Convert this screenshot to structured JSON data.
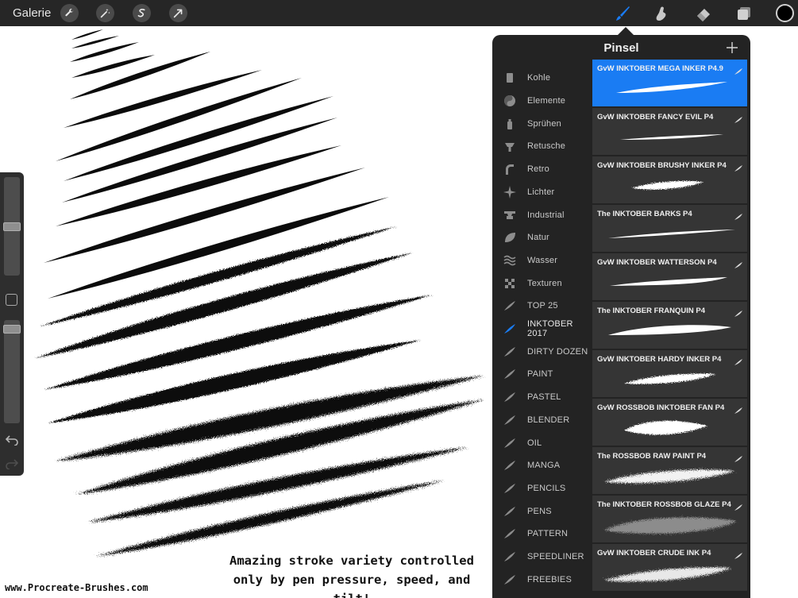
{
  "toolbar": {
    "gallery_label": "Galerie",
    "left_tools": [
      "wrench-icon",
      "magic-wand-icon",
      "selection-icon",
      "transform-arrow-icon"
    ],
    "right_tools": [
      "brush-icon",
      "smudge-icon",
      "eraser-icon",
      "layers-icon"
    ],
    "active_tool": "brush-icon",
    "accent_color": "#1a7cf3",
    "current_color": "#000000"
  },
  "sidebar": {
    "brush_size_level": 0.5,
    "opacity_level": 0.95
  },
  "panel": {
    "title": "Pinsel",
    "add_icon": "plus-icon",
    "categories": [
      {
        "label": "Kohle",
        "icon": "charcoal-icon"
      },
      {
        "label": "Elemente",
        "icon": "yin-yang-icon"
      },
      {
        "label": "Sprühen",
        "icon": "spray-can-icon"
      },
      {
        "label": "Retusche",
        "icon": "airbrush-icon"
      },
      {
        "label": "Retro",
        "icon": "retro-icon"
      },
      {
        "label": "Lichter",
        "icon": "sparkle-icon"
      },
      {
        "label": "Industrial",
        "icon": "anvil-icon"
      },
      {
        "label": "Natur",
        "icon": "leaf-icon"
      },
      {
        "label": "Wasser",
        "icon": "waves-icon"
      },
      {
        "label": "Texturen",
        "icon": "checker-icon"
      },
      {
        "label": "TOP 25",
        "icon": "brush-stroke-icon"
      },
      {
        "label": "INKTOBER 2017",
        "icon": "brush-stroke-icon",
        "active": true
      },
      {
        "label": "DIRTY DOZEN",
        "icon": "brush-stroke-icon"
      },
      {
        "label": "PAINT",
        "icon": "brush-stroke-icon"
      },
      {
        "label": "PASTEL",
        "icon": "brush-stroke-icon"
      },
      {
        "label": "BLENDER",
        "icon": "brush-stroke-icon"
      },
      {
        "label": "OIL",
        "icon": "brush-stroke-icon"
      },
      {
        "label": "MANGA",
        "icon": "brush-stroke-icon"
      },
      {
        "label": "PENCILS",
        "icon": "brush-stroke-icon"
      },
      {
        "label": "PENS",
        "icon": "brush-stroke-icon"
      },
      {
        "label": "PATTERN",
        "icon": "brush-stroke-icon"
      },
      {
        "label": "SPEEDLINER",
        "icon": "brush-stroke-icon"
      },
      {
        "label": "FREEBIES",
        "icon": "brush-stroke-icon"
      }
    ],
    "brushes": [
      {
        "name": "GvW INKTOBER MEGA INKER P4.9",
        "selected": true
      },
      {
        "name": "GvW INKTOBER FANCY EVIL P4"
      },
      {
        "name": "GvW INKTOBER BRUSHY INKER P4"
      },
      {
        "name": "The INKTOBER BARKS P4"
      },
      {
        "name": "GvW INKTOBER WATTERSON P4"
      },
      {
        "name": "The INKTOBER FRANQUIN P4"
      },
      {
        "name": "GvW INKTOBER HARDY INKER P4"
      },
      {
        "name": "GvW ROSSBOB INKTOBER FAN P4"
      },
      {
        "name": "The ROSSBOB RAW PAINT P4"
      },
      {
        "name": "The INKTOBER ROSSBOB GLAZE P4"
      },
      {
        "name": "GvW INKTOBER CRUDE INK P4"
      }
    ]
  },
  "caption": {
    "line1": "Amazing stroke variety controlled",
    "line2": "only by pen pressure, speed, and tilt!"
  },
  "watermark": "www.Procreate-Brushes.com"
}
